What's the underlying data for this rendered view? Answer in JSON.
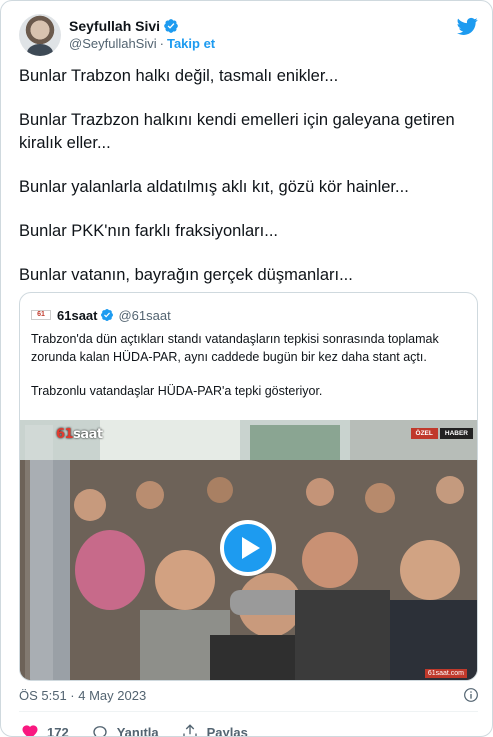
{
  "author": {
    "name": "Seyfullah Sivi",
    "handle": "@SeyfullahSivi",
    "separator": "·",
    "follow_label": "Takip et"
  },
  "tweet_lines": [
    "Bunlar Trabzon halkı değil, tasmalı enikler...",
    "Bunlar Trazbzon halkını kendi emelleri için galeyana getiren kiralık eller...",
    "Bunlar yalanlarla aldatılmış aklı kıt, gözü kör hainler...",
    "Bunlar PKK'nın farklı fraksiyonları...",
    "Bunlar vatanın, bayrağın gerçek düşmanları..."
  ],
  "quote": {
    "logo_text": "61",
    "name": "61saat",
    "handle": "@61saat",
    "paragraphs": [
      "Trabzon'da dün açtıkları standı vatandaşların tepkisi sonrasında toplamak zorunda kalan HÜDA-PAR, aynı caddede bugün bir kez daha stant açtı.",
      "Trabzonlu vatandaşlar HÜDA-PAR'a tepki gösteriyor."
    ],
    "video": {
      "logo": "61saat",
      "badge_left": "ÖZEL",
      "badge_right": "HABER",
      "site": "61saat.com"
    }
  },
  "timestamp": "ÖS 5:51 · 4 May 2023",
  "actions": {
    "likes": "172",
    "reply_label": "Yanıtla",
    "share_label": "Paylaş"
  },
  "colors": {
    "accent": "#1d9bf0",
    "like": "#f91880",
    "text": "#0f1419",
    "muted": "#536471"
  }
}
